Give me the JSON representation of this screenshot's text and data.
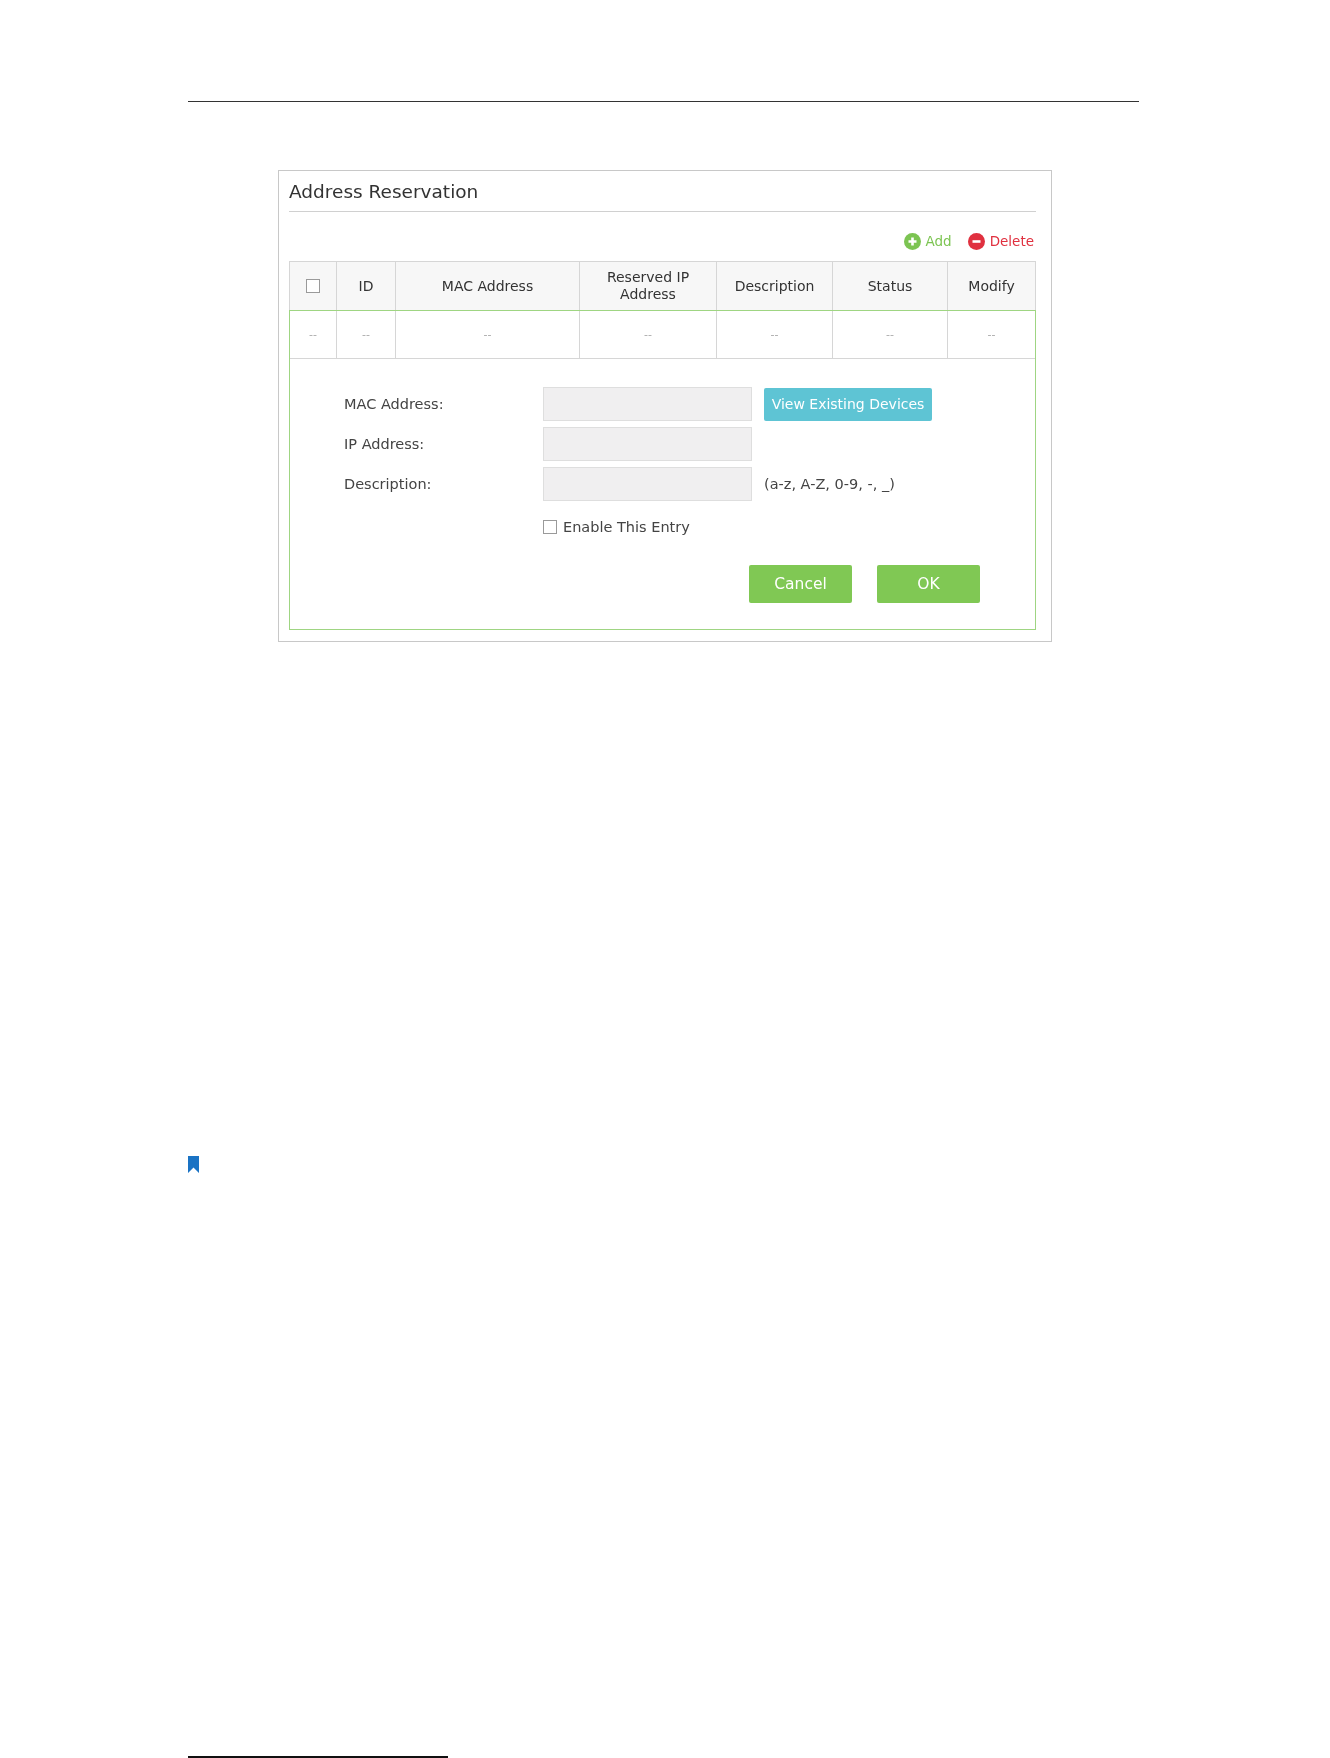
{
  "panel": {
    "title": "Address Reservation"
  },
  "toolbar": [
    {
      "kind": "add",
      "label": "Add"
    },
    {
      "kind": "delete",
      "label": "Delete"
    }
  ],
  "table": {
    "columns": [
      {
        "kind": "select",
        "checked": false
      },
      {
        "kind": "text",
        "label": "ID"
      },
      {
        "kind": "text",
        "label": "MAC Address"
      },
      {
        "kind": "text",
        "label": "Reserved IP Address"
      },
      {
        "kind": "text",
        "label": "Description"
      },
      {
        "kind": "text",
        "label": "Status"
      },
      {
        "kind": "text",
        "label": "Modify"
      }
    ],
    "rows": [
      {
        "cells": [
          "--",
          "--",
          "--",
          "--",
          "--",
          "--",
          "--"
        ]
      }
    ]
  },
  "form": {
    "fields": [
      {
        "label": "MAC Address:",
        "button": "View Existing Devices"
      },
      {
        "label": "IP Address:"
      },
      {
        "label": "Description:",
        "hint": "(a-z, A-Z, 0-9, -, _)"
      }
    ],
    "enable_entry": {
      "label": "Enable This Entry",
      "checked": false
    },
    "buttons": [
      "Cancel",
      "OK"
    ]
  }
}
